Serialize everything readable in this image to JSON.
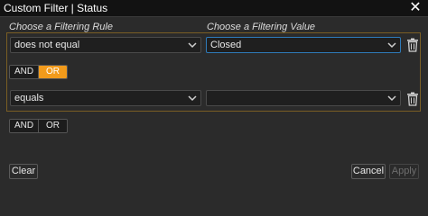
{
  "window": {
    "title": "Custom Filter | Status",
    "close_icon": "close-icon"
  },
  "columns": {
    "rule_label": "Choose a Filtering Rule",
    "value_label": "Choose a Filtering Value"
  },
  "group": {
    "border_color": "#7a5e24",
    "condition": {
      "rule": "does not equal",
      "value": "Closed"
    },
    "operator": {
      "and_label": "AND",
      "or_label": "OR",
      "selected": "OR",
      "accent": "#f39b1b"
    },
    "condition2": {
      "rule": "equals",
      "value": ""
    }
  },
  "outer_operator": {
    "and_label": "AND",
    "or_label": "OR",
    "selected": ""
  },
  "footer": {
    "clear_label": "Clear",
    "cancel_label": "Cancel",
    "apply_label": "Apply",
    "apply_disabled": true
  }
}
